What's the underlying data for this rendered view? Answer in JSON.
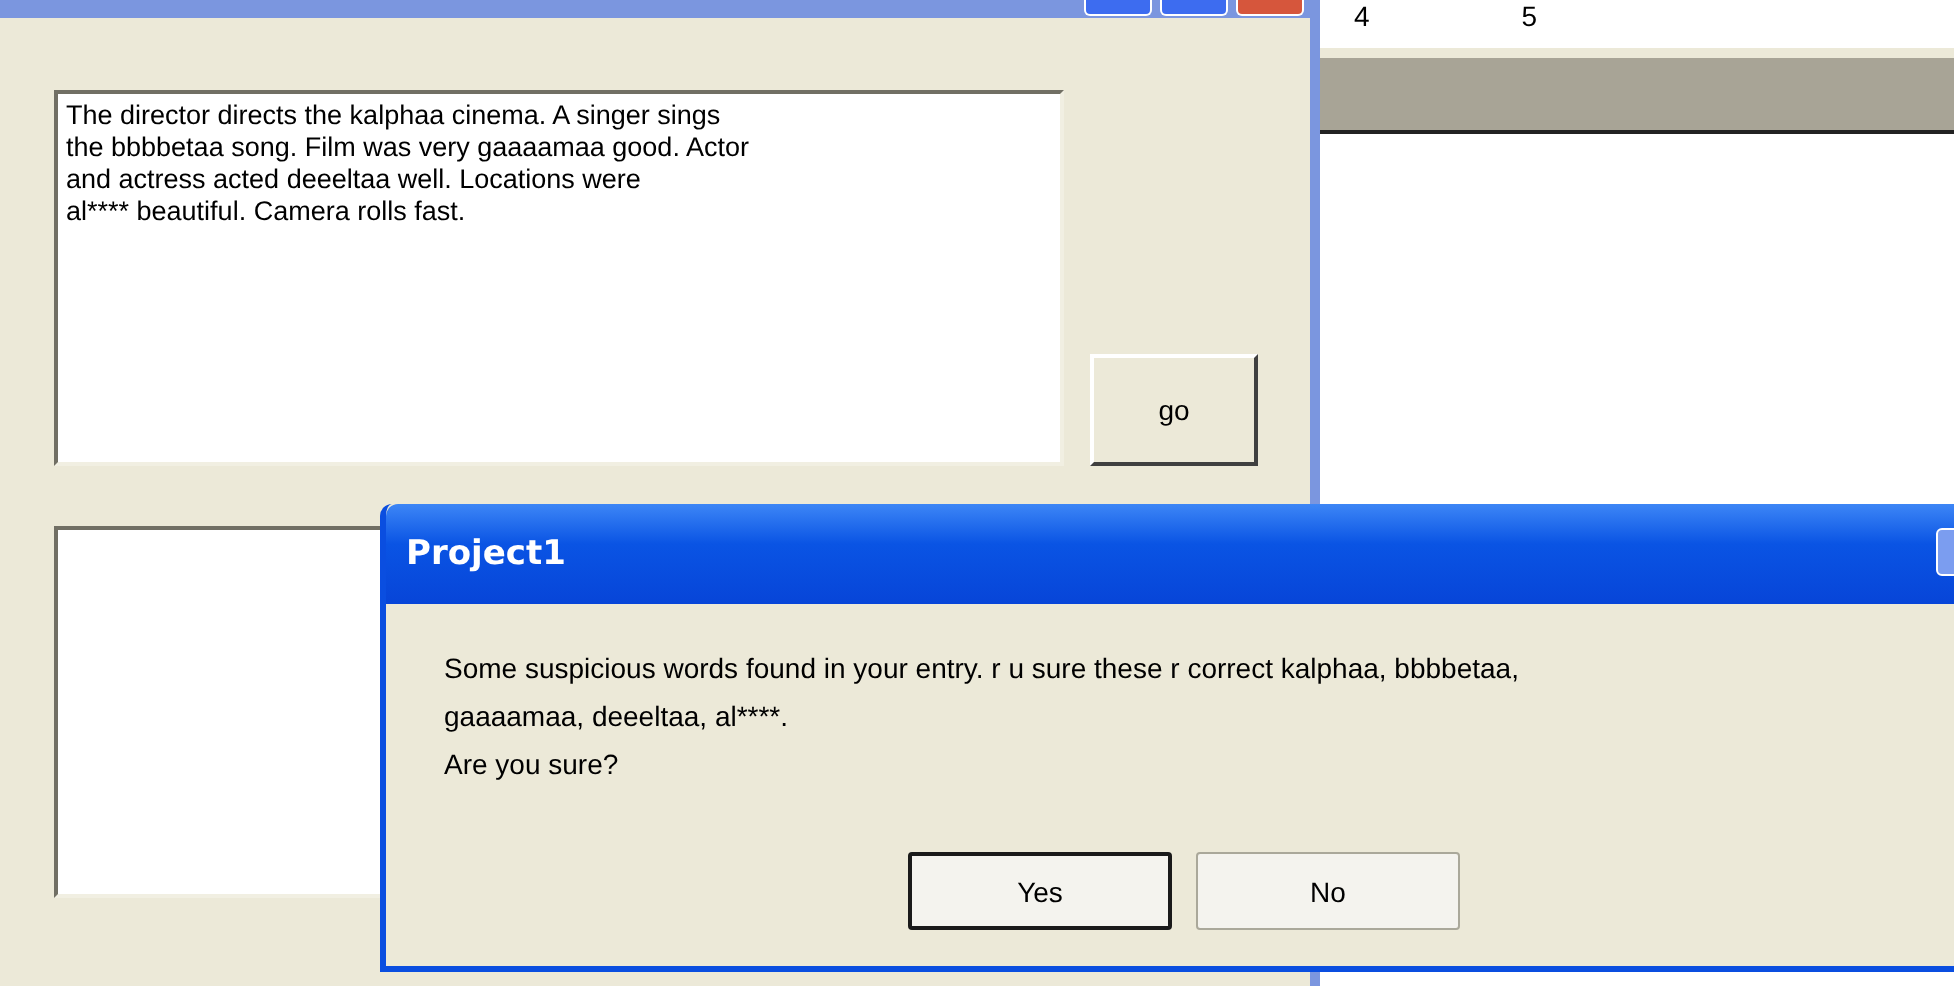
{
  "form": {
    "input_text": "The director directs the kalphaa cinema. A singer sings\nthe bbbbetaa song. Film was very gaaaamaa good. Actor\nand actress acted deeeltaa well. Locations were\nal**** beautiful. Camera rolls fast.",
    "go_button": "go"
  },
  "document": {
    "ruler_labels": [
      "4",
      "5"
    ]
  },
  "dialog": {
    "title": "Project1",
    "message": "Some suspicious words found in your entry. r u sure these r correct kalphaa, bbbbetaa,\ngaaaamaa, deeeltaa, al****.\nAre you sure?",
    "buttons": [
      {
        "label": "Yes",
        "default": true
      },
      {
        "label": "No",
        "default": false
      }
    ]
  }
}
